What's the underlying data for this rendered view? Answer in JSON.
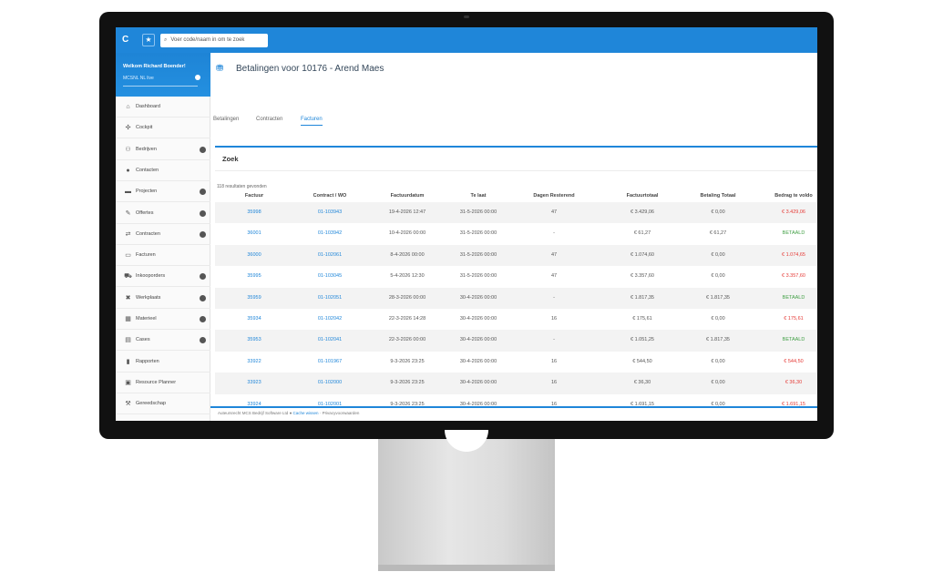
{
  "topbar": {
    "logo": "C",
    "star": "★",
    "search_icon": "search-icon",
    "search_placeholder": "Voer code/naam in om te zoek"
  },
  "sidebar": {
    "user_name": "Welkom Richard Boender!",
    "user_sub": "MCSNL NL live",
    "items": [
      {
        "label": "Dashboard",
        "icon": "⌂",
        "badge": false
      },
      {
        "label": "Cockpit",
        "icon": "✣",
        "badge": false
      },
      {
        "label": "Bedrijven",
        "icon": "⚇",
        "badge": true
      },
      {
        "label": "Contacten",
        "icon": "●",
        "badge": false
      },
      {
        "label": "Projecten",
        "icon": "▬",
        "badge": true
      },
      {
        "label": "Offertes",
        "icon": "✎",
        "badge": true
      },
      {
        "label": "Contracten",
        "icon": "⇄",
        "badge": true
      },
      {
        "label": "Facturen",
        "icon": "▭",
        "badge": false
      },
      {
        "label": "Inkooporders",
        "icon": "⛟",
        "badge": true
      },
      {
        "label": "Werkplaats",
        "icon": "✖",
        "badge": true
      },
      {
        "label": "Materieel",
        "icon": "▦",
        "badge": true
      },
      {
        "label": "Cases",
        "icon": "▤",
        "badge": true
      },
      {
        "label": "Rapporten",
        "icon": "▮",
        "badge": false
      },
      {
        "label": "Resource Planner",
        "icon": "▣",
        "badge": false
      },
      {
        "label": "Gereedschap",
        "icon": "⚒",
        "badge": false
      }
    ]
  },
  "page": {
    "title": "Betalingen voor 10176 - Arend Maes",
    "tabs": [
      "Betalingen",
      "Contracten",
      "Facturen"
    ],
    "active_tab": "Facturen",
    "search_label": "Zoek",
    "results_count": "118 resultaten gevonden"
  },
  "table": {
    "headers": [
      "Factuur",
      "Contract / WO",
      "Factuurdatum",
      "Te laat",
      "Dagen Resterend",
      "Factuurtotaal",
      "Betaling Totaal",
      "Bedrag te voldo"
    ],
    "rows": [
      {
        "factuur": "35998",
        "contract": "01-103943",
        "datum": "19-4-2026 12:47",
        "te_laat": "31-5-2026 00:00",
        "dagen": "47",
        "totaal": "€ 3.429,06",
        "betaald": "€ 0,00",
        "bedrag": "€ 3.429,06",
        "status": "due"
      },
      {
        "factuur": "36001",
        "contract": "01-103942",
        "datum": "10-4-2026 00:00",
        "te_laat": "31-5-2026 00:00",
        "dagen": "-",
        "totaal": "€ 61,27",
        "betaald": "€ 61,27",
        "bedrag": "BETAALD",
        "status": "paid"
      },
      {
        "factuur": "36000",
        "contract": "01-102061",
        "datum": "8-4-2026 00:00",
        "te_laat": "31-5-2026 00:00",
        "dagen": "47",
        "totaal": "€ 1.074,60",
        "betaald": "€ 0,00",
        "bedrag": "€ 1.074,65",
        "status": "due"
      },
      {
        "factuur": "35995",
        "contract": "01-103045",
        "datum": "5-4-2026 12:30",
        "te_laat": "31-5-2026 00:00",
        "dagen": "47",
        "totaal": "€ 3.357,60",
        "betaald": "€ 0,00",
        "bedrag": "€ 3.357,60",
        "status": "due"
      },
      {
        "factuur": "35959",
        "contract": "01-102051",
        "datum": "28-3-2026 00:00",
        "te_laat": "30-4-2026 00:00",
        "dagen": "-",
        "totaal": "€ 1.817,35",
        "betaald": "€ 1.817,35",
        "bedrag": "BETAALD",
        "status": "paid"
      },
      {
        "factuur": "35934",
        "contract": "01-102042",
        "datum": "22-3-2026 14:28",
        "te_laat": "30-4-2026 00:00",
        "dagen": "16",
        "totaal": "€ 175,61",
        "betaald": "€ 0,00",
        "bedrag": "€ 175,61",
        "status": "due"
      },
      {
        "factuur": "35953",
        "contract": "01-102041",
        "datum": "22-3-2026 00:00",
        "te_laat": "30-4-2026 00:00",
        "dagen": "-",
        "totaal": "€ 1.051,25",
        "betaald": "€ 1.817,35",
        "bedrag": "BETAALD",
        "status": "paid"
      },
      {
        "factuur": "33922",
        "contract": "01-101967",
        "datum": "9-3-2026 23:25",
        "te_laat": "30-4-2026 00:00",
        "dagen": "16",
        "totaal": "€ 544,50",
        "betaald": "€ 0,00",
        "bedrag": "€ 544,50",
        "status": "due"
      },
      {
        "factuur": "33923",
        "contract": "01-102000",
        "datum": "9-3-2026 23:25",
        "te_laat": "30-4-2026 00:00",
        "dagen": "16",
        "totaal": "€ 36,30",
        "betaald": "€ 0,00",
        "bedrag": "€ 36,30",
        "status": "due"
      },
      {
        "factuur": "33924",
        "contract": "01-102001",
        "datum": "9-3-2026 23:25",
        "te_laat": "30-4-2026 00:00",
        "dagen": "16",
        "totaal": "€ 1.691,15",
        "betaald": "€ 0,00",
        "bedrag": "€ 1.691,15",
        "status": "due"
      }
    ]
  },
  "footer": {
    "copyright": "Auteursrecht MCS Bedrijf Software Ltd",
    "cache_link": "Cache wissen",
    "privacy": "Privacyvoorwaarden"
  },
  "colors": {
    "accent": "#1f86d9",
    "due": "#e53935",
    "paid": "#43a047"
  }
}
